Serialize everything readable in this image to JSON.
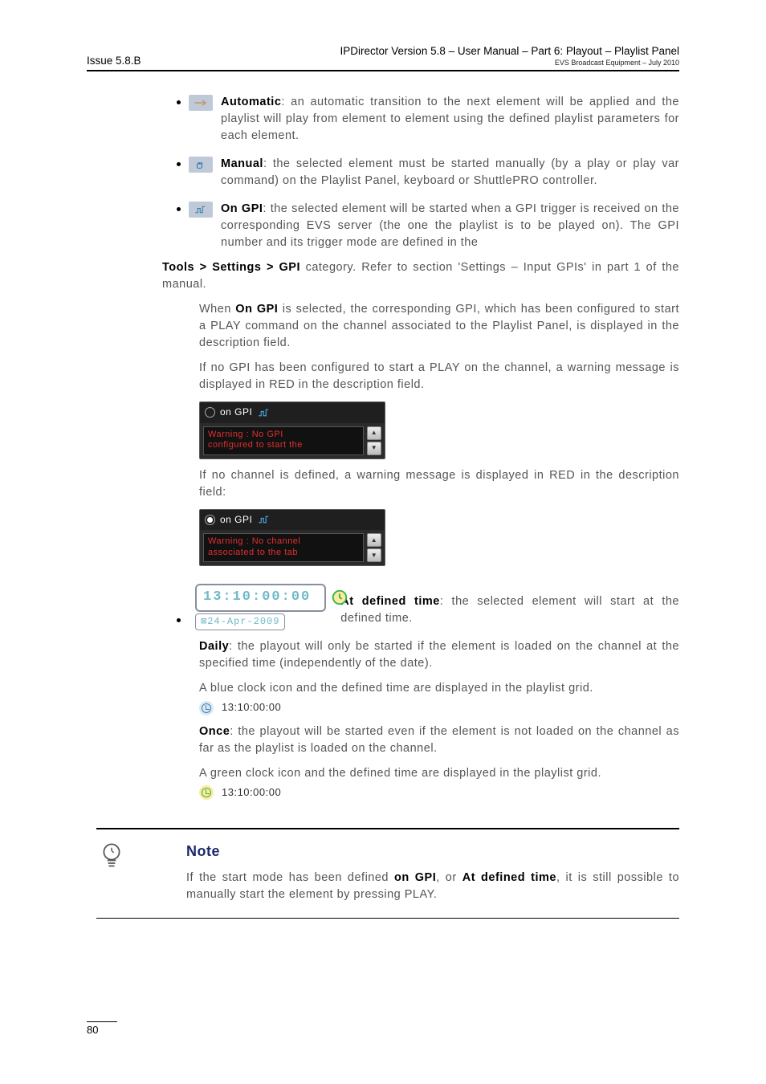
{
  "header": {
    "issue": "Issue 5.8.B",
    "product": "IPDirector Version 5.8 – User Manual – Part 6: Playout – Playlist Panel",
    "sub": "EVS Broadcast Equipment – July 2010"
  },
  "bullets": {
    "auto": {
      "label": "Automatic",
      "text": ": an automatic transition to the next element will be applied and the playlist will play from element to element using the defined playlist parameters for each element."
    },
    "manual": {
      "label": "Manual",
      "text": ": the selected element must be started manually (by a play or play var command) on the Playlist Panel, keyboard or ShuttlePRO controller."
    },
    "ongpi": {
      "label": "On GPI",
      "text1": ": the selected element will be started when a GPI trigger is received on the corresponding EVS server (the one the playlist is to be played on). The GPI number and its trigger mode are defined in the",
      "text2_link": "Tools > Settings > GPI",
      "text3": "category. Refer to section 'Settings – Input GPIs' in part 1 of the manual.",
      "when_a": "When",
      "when_b": "On GPI",
      "when_c": "is selected, the corresponding GPI, which has been configured to start a PLAY command on the channel associated to the Playlist Panel, is displayed in the description field.",
      "nogpi": "If no GPI has been configured to start a PLAY on the channel, a warning message is displayed in RED in the description field.",
      "nochan": "If no channel is defined, a warning message is displayed in RED in the description field:"
    },
    "gpi_ui": {
      "label": "on GPI",
      "warn_nogpi_l1": "Warning : No GPI",
      "warn_nogpi_l2": "configured to start the",
      "warn_nochan_l1": "Warning : No channel",
      "warn_nochan_l2": "associated to the tab"
    },
    "attime": {
      "label": "At defined time",
      "text": ": the selected element will start at the defined time.",
      "time": "13:10:00:00",
      "date": "⊠24-Apr-2009",
      "daily_label": "Daily",
      "daily_text": ": the playout will only be started if the element is loaded on the channel at the specified time (independently of the date).",
      "daily_line": "A blue clock icon and the defined time are displayed in the playlist grid.",
      "once_label": "Once",
      "once_text": ": the playout will be started even if the element is not loaded on the channel as far as the playlist is loaded on the channel.",
      "once_line": "A green clock icon and the defined time are displayed in the playlist grid.",
      "time_row": "13:10:00:00"
    }
  },
  "note": {
    "title": "Note",
    "text_a": "If the start mode has been defined",
    "text_b": "on GPI",
    "text_c": ", or",
    "text_d": "At defined time",
    "text_e": ", it is still possible to manually start the element by pressing PLAY."
  },
  "footer": {
    "page": "80"
  }
}
